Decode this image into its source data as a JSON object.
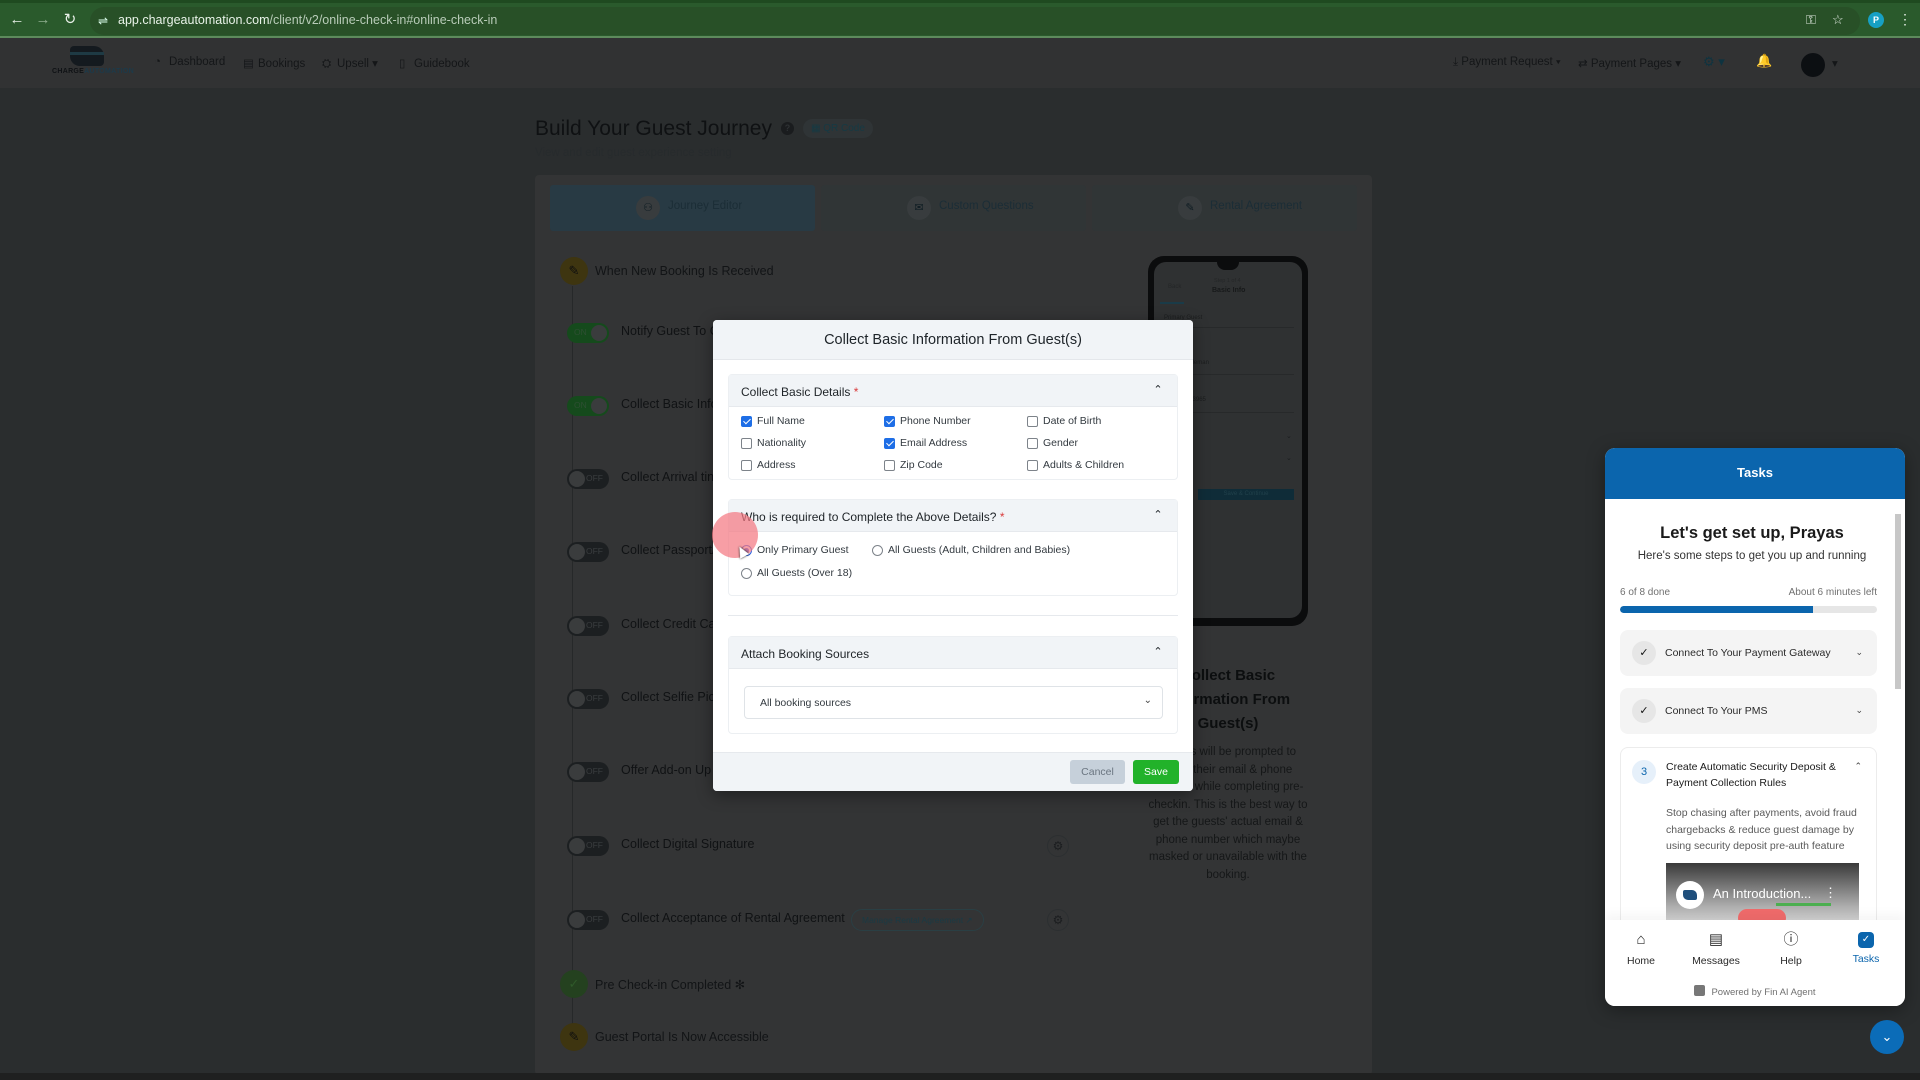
{
  "browser": {
    "url_host": "app.chargeautomation.com",
    "url_path": "/client/v2/online-check-in#online-check-in",
    "profile_initial": "P",
    "icons": [
      "back-icon",
      "forward-icon",
      "reload-icon",
      "site-info-icon",
      "password-key-icon",
      "bookmark-star-icon",
      "menu-kebab-icon"
    ]
  },
  "topnav": {
    "logo": {
      "word1": "CHARGE",
      "word2": "AUTOMATION"
    },
    "items": [
      {
        "label": "Dashboard",
        "icon": "dashboard-icon"
      },
      {
        "label": "Bookings",
        "icon": "bookings-icon"
      },
      {
        "label": "Upsell",
        "icon": "upsell-icon",
        "dropdown": true
      },
      {
        "label": "Guidebook",
        "icon": "guidebook-icon"
      }
    ],
    "right": [
      {
        "label": "Payment Request",
        "icon": "payment-request-icon",
        "dropdown": true
      },
      {
        "label": "Payment Pages",
        "icon": "payment-pages-icon",
        "dropdown": true
      }
    ]
  },
  "page": {
    "title": "Build Your Guest Journey",
    "qr_label": "QR Code",
    "subtitle": "View and edit guest experience setting",
    "tabs": [
      {
        "label": "Journey Editor",
        "active": true
      },
      {
        "label": "Custom Questions",
        "active": false
      },
      {
        "label": "Rental Agreement",
        "active": false
      }
    ],
    "milestones": {
      "new_booking": "When New Booking Is Received",
      "precheckin_done": "Pre Check-in Completed",
      "portal_accessible": "Guest Portal Is Now Accessible"
    },
    "steps": [
      {
        "label": "Notify Guest To C",
        "state": "ON"
      },
      {
        "label": "Collect Basic Info",
        "state": "ON"
      },
      {
        "label": "Collect Arrival tin",
        "state": "OFF"
      },
      {
        "label": "Collect Passport/",
        "state": "OFF"
      },
      {
        "label": "Collect Credit Ca",
        "state": "OFF"
      },
      {
        "label": "Collect Selfie Pict",
        "state": "OFF"
      },
      {
        "label": "Offer Add-on Up",
        "state": "OFF"
      },
      {
        "label": "Collect Digital Signature",
        "state": "OFF"
      },
      {
        "label": "Collect Acceptance of Rental Agreement",
        "state": "OFF",
        "chip": "Manage Rental Agreement"
      }
    ],
    "preview": {
      "phone": {
        "back": "Back",
        "step": "Step 1 of 4",
        "title": "Basic Info",
        "field1": "Primary Guest",
        "name_value": "Jeff Stampleman",
        "phone_value": "+1 4277043965",
        "button": "Save & Continue"
      },
      "title": "Collect Basic Information From Guest(s)",
      "description": "Guests will be prompted to enter their email & phone number while completing pre-checkin. This is the best way to get the guests' actual email & phone number which maybe masked or unavailable with the booking."
    }
  },
  "modal": {
    "title": "Collect Basic Information From Guest(s)",
    "basic_details": {
      "title": "Collect Basic Details",
      "required_mark": "*",
      "fields": [
        {
          "label": "Full Name",
          "checked": true
        },
        {
          "label": "Phone Number",
          "checked": true
        },
        {
          "label": "Date of Birth",
          "checked": false
        },
        {
          "label": "Nationality",
          "checked": false
        },
        {
          "label": "Email Address",
          "checked": true
        },
        {
          "label": "Gender",
          "checked": false
        },
        {
          "label": "Address",
          "checked": false
        },
        {
          "label": "Zip Code",
          "checked": false
        },
        {
          "label": "Adults & Children",
          "checked": false
        }
      ]
    },
    "who_required": {
      "title": "Who is required to Complete the Above Details?",
      "required_mark": "*",
      "options": [
        {
          "label": "Only Primary Guest",
          "selected": true
        },
        {
          "label": "All Guests (Adult, Children and Babies)",
          "selected": false
        },
        {
          "label": "All Guests (Over 18)",
          "selected": false
        }
      ]
    },
    "booking_sources": {
      "title": "Attach Booking Sources",
      "selected": "All booking sources"
    },
    "cancel_label": "Cancel",
    "save_label": "Save",
    "save_color": "#22b22a"
  },
  "tasks": {
    "header": "Tasks",
    "greeting": "Let's get set up, Prayas",
    "subgreeting": "Here's some steps to get you up and running",
    "done_count": 6,
    "total_count": 8,
    "progress_text": "6 of 8 done",
    "time_left": "About 6 minutes left",
    "items": [
      {
        "label": "Connect To Your Payment Gateway",
        "done": true
      },
      {
        "label": "Connect To Your PMS",
        "done": true
      },
      {
        "number": "3",
        "label": "Create Automatic Security Deposit & Payment Collection Rules",
        "description": "Stop chasing after payments, avoid fraud chargebacks & reduce guest damage by using security deposit pre-auth feature",
        "video_title": "An Introduction...",
        "expanded": true
      }
    ],
    "nav": [
      {
        "label": "Home",
        "icon": "home-icon",
        "active": false
      },
      {
        "label": "Messages",
        "icon": "messages-icon",
        "active": false
      },
      {
        "label": "Help",
        "icon": "help-icon",
        "active": false
      },
      {
        "label": "Tasks",
        "icon": "tasks-icon",
        "active": true
      }
    ],
    "powered_by": "Powered by Fin AI Agent",
    "accent": "#0b65ad"
  }
}
